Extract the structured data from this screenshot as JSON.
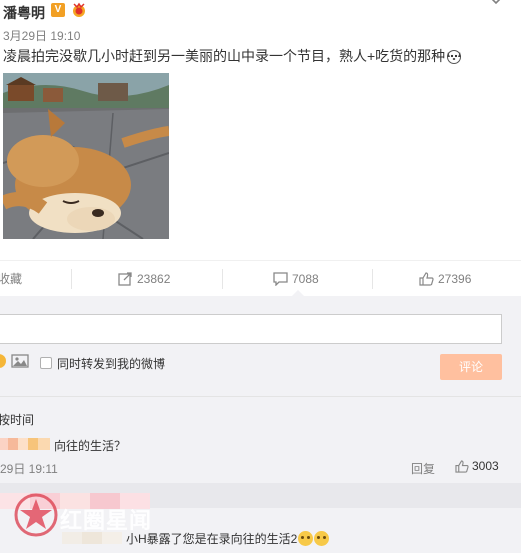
{
  "post": {
    "author": "潘粤明",
    "vip_badge": "V",
    "time": "3月29日 19:10",
    "text": "凌晨拍完没歇几小时赶到另一美丽的山中录一个节目，熟人+吃货的那种"
  },
  "actions": {
    "favorite": "收藏",
    "repost_count": "23862",
    "comment_count": "7088",
    "like_count": "27396"
  },
  "comment_box": {
    "repost_option": "同时转发到我的微博",
    "submit": "评论"
  },
  "sort": {
    "label": "按时间"
  },
  "comments": [
    {
      "text": "向往的生活？",
      "time": "29日 19:11",
      "reply": "回复",
      "likes": "3003"
    },
    {
      "text": "小H暴露了您是在录向往的生活2"
    }
  ],
  "watermark": "红圈星闻",
  "colors": {
    "accent_orange": "#ff8140",
    "submit_disabled": "#ffc09f",
    "panel_bg": "#f2f2f5",
    "muted_text": "#808080"
  }
}
